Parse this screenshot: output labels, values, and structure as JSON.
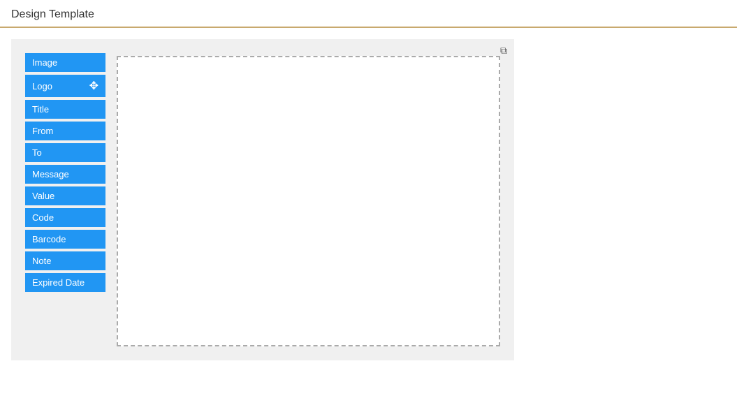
{
  "header": {
    "title": "Design Template"
  },
  "canvas": {
    "edit_icon": "✎"
  },
  "elements": [
    {
      "label": "Image",
      "id": "image"
    },
    {
      "label": "Logo",
      "id": "logo",
      "has_move": true
    },
    {
      "label": "Title",
      "id": "title"
    },
    {
      "label": "From",
      "id": "from"
    },
    {
      "label": "To",
      "id": "to"
    },
    {
      "label": "Message",
      "id": "message"
    },
    {
      "label": "Value",
      "id": "value"
    },
    {
      "label": "Code",
      "id": "code"
    },
    {
      "label": "Barcode",
      "id": "barcode"
    },
    {
      "label": "Note",
      "id": "note"
    },
    {
      "label": "Expired Date",
      "id": "expired-date"
    }
  ]
}
